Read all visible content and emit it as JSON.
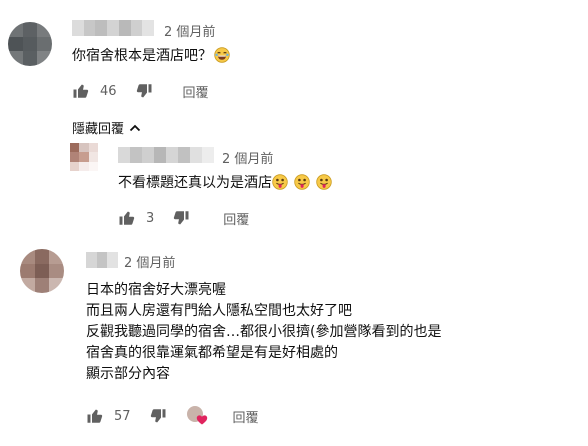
{
  "comments": [
    {
      "timestamp": "2 個月前",
      "text_lines": [
        "你宿舍根本是酒店吧？"
      ],
      "likes": "46",
      "reply_label": "回覆"
    },
    {
      "timestamp": "2 個月前",
      "text_lines": [
        "不看標題还真以为是酒店"
      ],
      "likes": "3",
      "reply_label": "回覆"
    },
    {
      "timestamp": "2 個月前",
      "text_lines": [
        "日本的宿舍好大漂亮喔",
        "而且兩人房還有門給人隱私空間也太好了吧",
        "反觀我聽過同學的宿舍…都很小很擠(參加營隊看到的也是",
        "宿舍真的很靠運氣都希望是有是好相處的"
      ],
      "show_more_label": "顯示部分內容",
      "likes": "57",
      "reply_label": "回覆"
    }
  ],
  "toggle_replies_label": "隱藏回覆",
  "icons": {
    "like": "thumbs-up-icon",
    "dislike": "thumbs-down-icon",
    "creator_heart": "creator-heart-icon",
    "toggle": "chevron-up-icon"
  },
  "colors": {
    "text": "#0f0f0f",
    "secondary": "#606060",
    "heart": "#e0245e"
  }
}
